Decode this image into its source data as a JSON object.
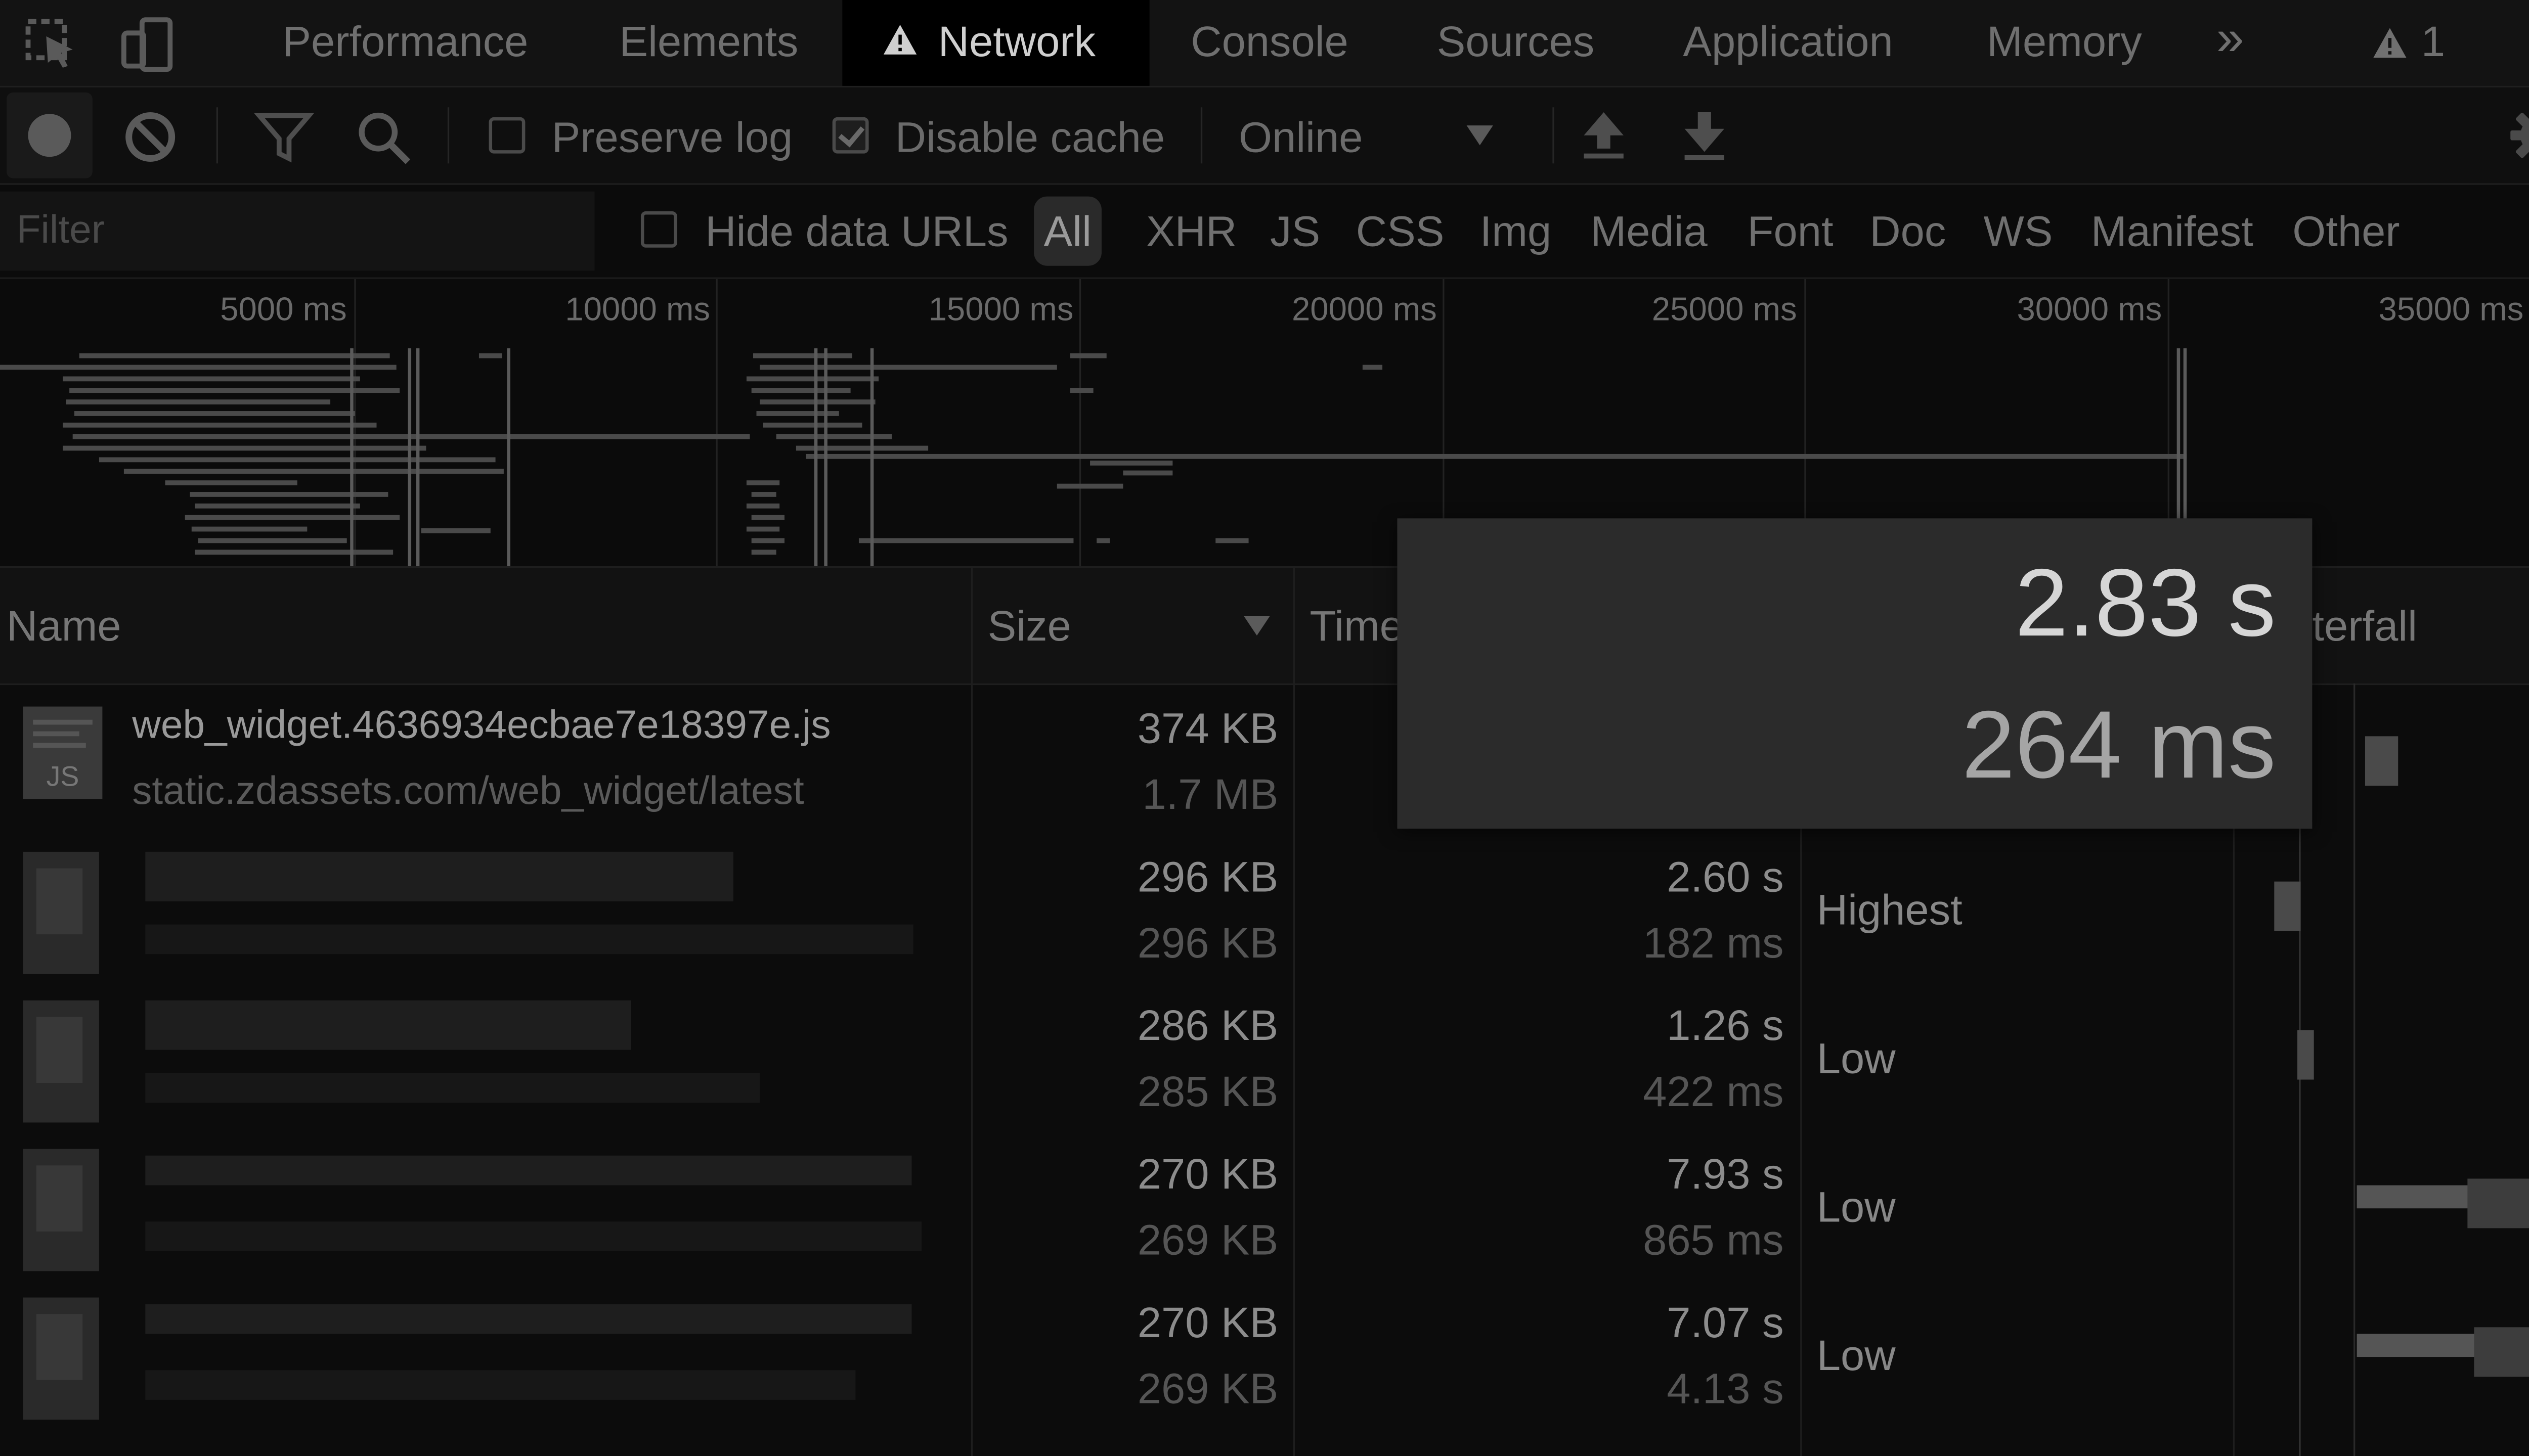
{
  "tabs": [
    {
      "label": "Performance"
    },
    {
      "label": "Elements"
    },
    {
      "label": "Network",
      "warning": true
    },
    {
      "label": "Console"
    },
    {
      "label": "Sources"
    },
    {
      "label": "Application"
    },
    {
      "label": "Memory"
    }
  ],
  "tab_overflow": "»",
  "warning_count": "1",
  "toolbar": {
    "preserve_log": {
      "label": "Preserve log",
      "checked": false
    },
    "disable_cache": {
      "label": "Disable cache",
      "checked": true
    },
    "throttle": "Online"
  },
  "filter": {
    "placeholder": "Filter",
    "hide_data_urls": "Hide data URLs",
    "types": [
      "All",
      "XHR",
      "JS",
      "CSS",
      "Img",
      "Media",
      "Font",
      "Doc",
      "WS",
      "Manifest",
      "Other"
    ],
    "active_type": "All"
  },
  "overview": {
    "ticks": [
      "5000 ms",
      "10000 ms",
      "15000 ms",
      "20000 ms",
      "25000 ms",
      "30000 ms",
      "35000 ms"
    ]
  },
  "table": {
    "columns": {
      "name": "Name",
      "size": "Size",
      "time": "Time",
      "waterfall": "terfall"
    },
    "rows": [
      {
        "name": "web_widget.4636934ecbae7e18397e.js",
        "url": "static.zdassets.com/web_widget/latest",
        "icon_label": "JS",
        "size": "374 KB",
        "resource": "1.7 MB",
        "time": "",
        "latency": "",
        "priority": ""
      },
      {
        "name": "",
        "url": "",
        "size": "296 KB",
        "resource": "296 KB",
        "time": "2.60 s",
        "latency": "182 ms",
        "priority": "Highest"
      },
      {
        "name": "",
        "url": "",
        "size": "286 KB",
        "resource": "285 KB",
        "time": "1.26 s",
        "latency": "422 ms",
        "priority": "Low"
      },
      {
        "name": "",
        "url": "",
        "size": "270 KB",
        "resource": "269 KB",
        "time": "7.93 s",
        "latency": "865 ms",
        "priority": "Low"
      },
      {
        "name": "",
        "url": "",
        "size": "270 KB",
        "resource": "269 KB",
        "time": "7.07 s",
        "latency": "4.13 s",
        "priority": "Low"
      }
    ]
  },
  "tooltip": {
    "time": "2.83 s",
    "latency": "264 ms"
  }
}
